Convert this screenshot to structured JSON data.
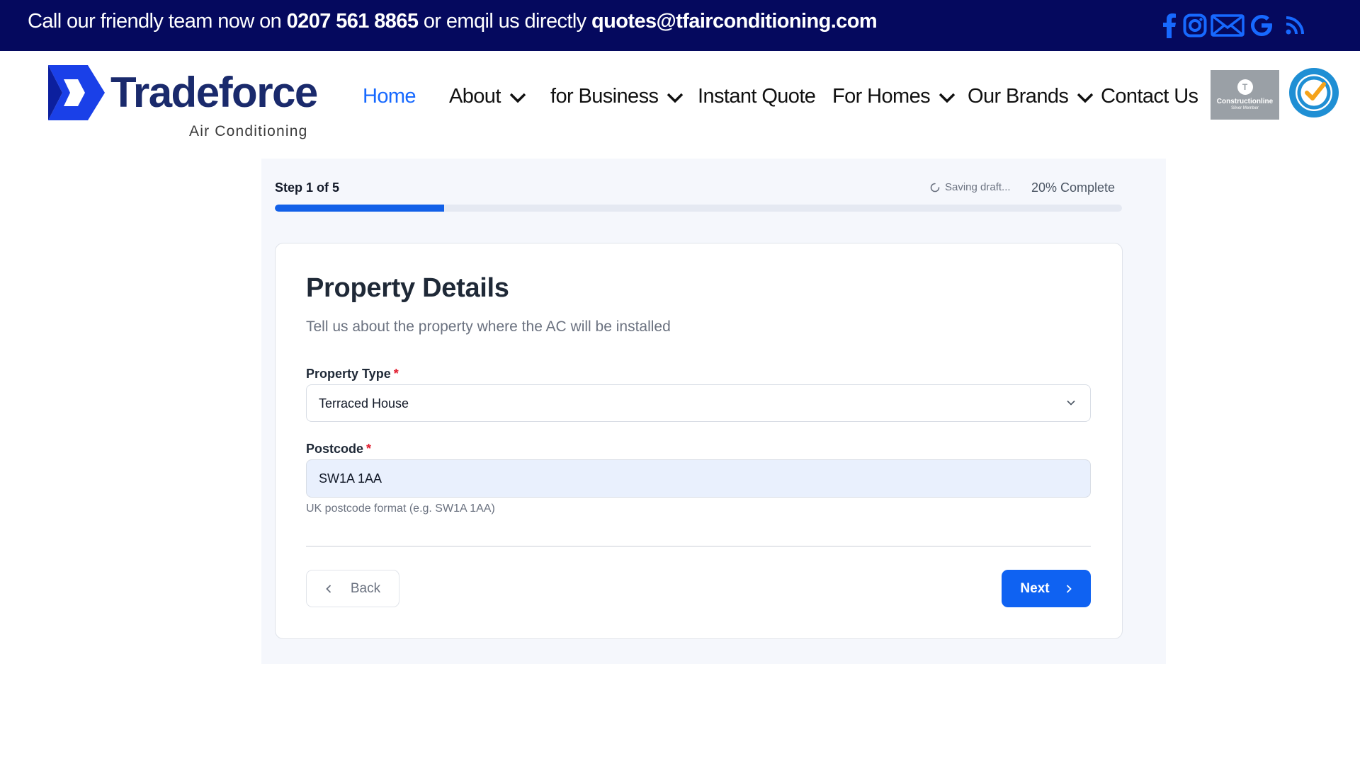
{
  "topbar": {
    "contact_prefix": "Call our friendly team now on ",
    "phone": "0207 561 8865",
    "contact_middle": " or emqil us directly ",
    "email": "quotes@tfairconditioning.com",
    "social_icons": [
      "facebook-icon",
      "instagram-icon",
      "email-icon",
      "google-icon",
      "rss-icon"
    ],
    "background_color": "#05095e",
    "icon_color": "#1769ff"
  },
  "header": {
    "logo_name": "Tradeforce",
    "logo_sub": "Air Conditioning",
    "nav": [
      {
        "label": "Home",
        "active": true,
        "has_dropdown": false
      },
      {
        "label": "About",
        "active": false,
        "has_dropdown": true
      },
      {
        "label": "for Business",
        "active": false,
        "has_dropdown": true
      },
      {
        "label": "Instant Quote",
        "active": false,
        "has_dropdown": false
      },
      {
        "label": "For Homes",
        "active": false,
        "has_dropdown": true
      },
      {
        "label": "Our Brands",
        "active": false,
        "has_dropdown": true
      },
      {
        "label": "Contact Us",
        "active": false,
        "has_dropdown": false
      }
    ],
    "badges": [
      {
        "name": "Constructionline",
        "caption": "Silver Member"
      },
      {
        "name": "trustatrader",
        "caption": ""
      }
    ],
    "active_color": "#1769ff"
  },
  "form": {
    "step_label": "Step 1 of 5",
    "saving_text": "Saving draft...",
    "complete_text": "20% Complete",
    "progress_fraction": 0.2,
    "progress_color": "#1260e8",
    "title": "Property Details",
    "subtitle": "Tell us about the property where the AC will be installed",
    "fields": {
      "property_type": {
        "label": "Property Type",
        "required_marker": "*",
        "value": "Terraced House"
      },
      "postcode": {
        "label": "Postcode",
        "required_marker": "*",
        "value": "SW1A 1AA",
        "hint": "UK postcode format (e.g. SW1A 1AA)"
      }
    },
    "back_label": "Back",
    "next_label": "Next",
    "primary_color": "#0f62f2"
  }
}
